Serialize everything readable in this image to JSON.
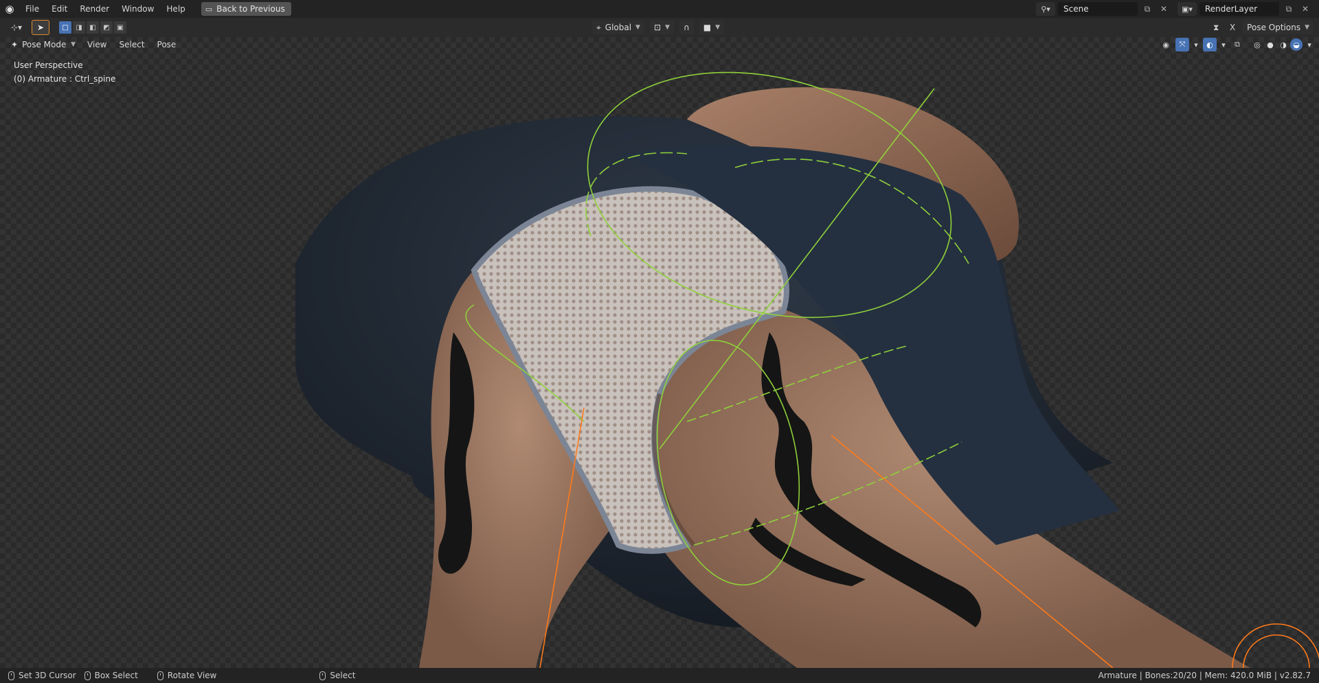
{
  "topbar": {
    "logo_icon": "blender-logo-icon",
    "menu": [
      "File",
      "Edit",
      "Render",
      "Window",
      "Help"
    ],
    "back_button": "Back to Previous",
    "scene": "Scene",
    "render_layer": "RenderLayer"
  },
  "toolheader": {
    "transform_orientation": "Global",
    "pose_options": "Pose Options",
    "x_label": "X"
  },
  "viewport_header": {
    "mode": "Pose Mode",
    "menus": [
      "View",
      "Select",
      "Pose"
    ]
  },
  "viewport": {
    "perspective": "User Perspective",
    "active_object": "(0) Armature : Ctrl_spine"
  },
  "statusbar": {
    "items": [
      "Set 3D Cursor",
      "Box Select",
      "Rotate View",
      "Select"
    ],
    "info": "Armature | Bones:20/20 | Mem: 420.0 MiB | v2.82.7"
  },
  "colors": {
    "accent_blue": "#4772b3",
    "active_tool_outline": "#e08a2a",
    "bone_green": "#8fd13a",
    "bone_orange": "#ff7a1a"
  }
}
